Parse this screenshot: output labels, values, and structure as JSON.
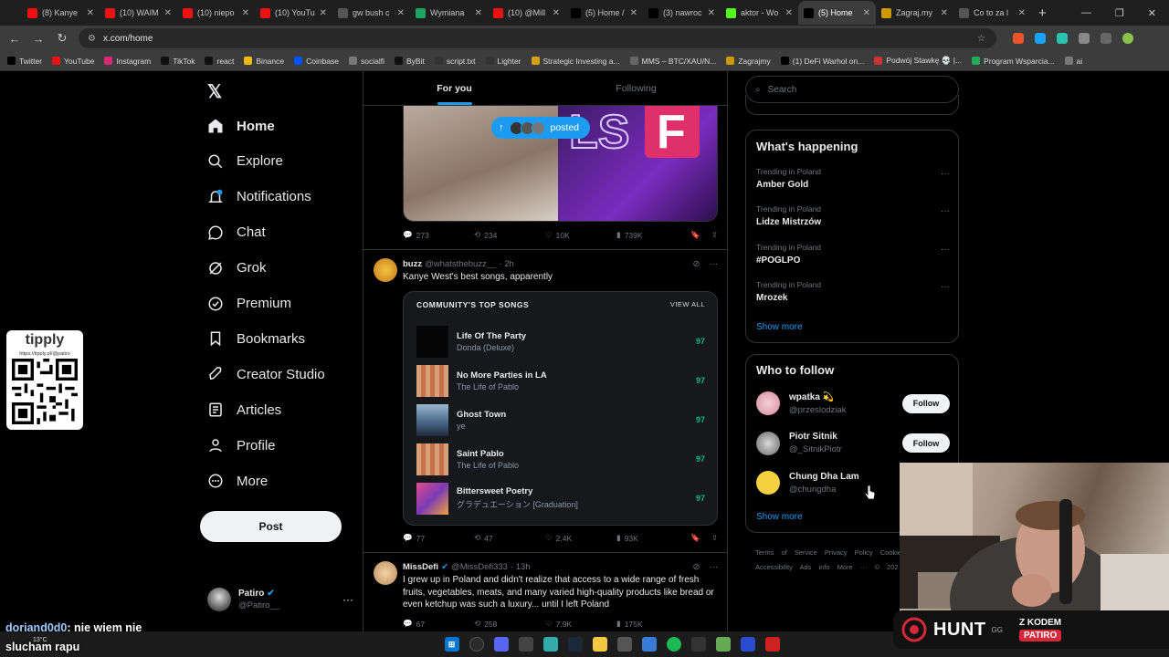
{
  "browser": {
    "tabs": [
      {
        "label": "(8) Kanye",
        "icon": "youtube-icon",
        "color": "#e11"
      },
      {
        "label": "(10) WAIM",
        "icon": "youtube-icon",
        "color": "#e11"
      },
      {
        "label": "(10) niepo",
        "icon": "youtube-icon",
        "color": "#e11"
      },
      {
        "label": "(10) YouTu",
        "icon": "youtube-icon",
        "color": "#e11"
      },
      {
        "label": "gw bush c",
        "icon": "google-icon",
        "color": "#555"
      },
      {
        "label": "Wymiana",
        "icon": "sheet-icon",
        "color": "#1da462"
      },
      {
        "label": "(10) @Mill",
        "icon": "youtube-icon",
        "color": "#e11"
      },
      {
        "label": "(5) Home /",
        "icon": "x-icon",
        "color": "#000"
      },
      {
        "label": "(3) nawroc",
        "icon": "x-icon",
        "color": "#000"
      },
      {
        "label": "aktor - Wo",
        "icon": "kick-icon",
        "color": "#53fc18"
      },
      {
        "label": "(5) Home",
        "icon": "x-icon",
        "color": "#000",
        "active": true
      },
      {
        "label": "Zagraj.my",
        "icon": "person-icon",
        "color": "#c90"
      },
      {
        "label": "Co to za l",
        "icon": "globe-icon",
        "color": "#555"
      }
    ],
    "new_tab": "+",
    "url": "x.com/home",
    "bookmarks": [
      {
        "label": "Twitter",
        "color": "#000"
      },
      {
        "label": "YouTube",
        "color": "#e11"
      },
      {
        "label": "Instagram",
        "color": "#d62976"
      },
      {
        "label": "TikTok",
        "color": "#111"
      },
      {
        "label": "react",
        "color": "#111"
      },
      {
        "label": "Binance",
        "color": "#f0b90b"
      },
      {
        "label": "Coinbase",
        "color": "#0052ff"
      },
      {
        "label": "socialfi",
        "color": "#777"
      },
      {
        "label": "ByBit",
        "color": "#111"
      },
      {
        "label": "script.txt",
        "color": "#333"
      },
      {
        "label": "Lighter",
        "color": "#333"
      },
      {
        "label": "Strategic Investing a...",
        "color": "#d4a017"
      },
      {
        "label": "MMS – BTC/XAU/N...",
        "color": "#666"
      },
      {
        "label": "Zagrajmy",
        "color": "#c90"
      },
      {
        "label": "(1) DeFi Warhol on...",
        "color": "#000"
      },
      {
        "label": "Podwój Stawkę 💀 |...",
        "color": "#c33"
      },
      {
        "label": "Program Wsparcia...",
        "color": "#2a5"
      },
      {
        "label": "ai",
        "color": "#777"
      }
    ]
  },
  "sidebar": {
    "nav": [
      {
        "label": "Home",
        "icon": "home-icon"
      },
      {
        "label": "Explore",
        "icon": "search-icon"
      },
      {
        "label": "Notifications",
        "icon": "bell-icon"
      },
      {
        "label": "Chat",
        "icon": "chat-icon"
      },
      {
        "label": "Grok",
        "icon": "grok-icon"
      },
      {
        "label": "Premium",
        "icon": "premium-icon"
      },
      {
        "label": "Bookmarks",
        "icon": "bookmark-icon"
      },
      {
        "label": "Creator Studio",
        "icon": "rocket-icon"
      },
      {
        "label": "Articles",
        "icon": "article-icon"
      },
      {
        "label": "Profile",
        "icon": "person-icon"
      },
      {
        "label": "More",
        "icon": "more-icon"
      }
    ],
    "post_label": "Post",
    "account": {
      "name": "Patiro",
      "handle": "@Patiro__"
    }
  },
  "timeline": {
    "tabs": [
      "For you",
      "Following"
    ],
    "posted_label": "posted",
    "tweet1": {
      "replies": "273",
      "reposts": "234",
      "likes": "10K",
      "views": "739K"
    },
    "tweet2": {
      "name": "buzz",
      "handle": "@whatsthebuzz__",
      "time": "· 2h",
      "text": "Kanye West's best songs, apparently",
      "card_title": "COMMUNITY'S TOP SONGS",
      "card_view_all": "VIEW ALL",
      "songs": [
        {
          "title": "Life Of The Party",
          "album": "Donda (Deluxe)",
          "score": "97"
        },
        {
          "title": "No More Parties in LA",
          "album": "The Life of Pablo",
          "score": "97"
        },
        {
          "title": "Ghost Town",
          "album": "ye",
          "score": "97"
        },
        {
          "title": "Saint Pablo",
          "album": "The Life of Pablo",
          "score": "97"
        },
        {
          "title": "Bittersweet Poetry",
          "album": "グラデュエーション [Graduation]",
          "score": "97"
        }
      ],
      "replies": "77",
      "reposts": "47",
      "likes": "2.4K",
      "views": "93K"
    },
    "tweet3": {
      "name": "MissDefi",
      "handle": "@MissDefi333",
      "time": "· 13h",
      "text": "I grew up in Poland and didn't realize that access to a wide range of fresh fruits, vegetables, meats, and many varied high-quality products like bread or even ketchup was such a luxury... until I left Poland",
      "replies": "67",
      "reposts": "258",
      "likes": "7.9K",
      "views": "175K"
    }
  },
  "right": {
    "search_placeholder": "Search",
    "happening_title": "What's happening",
    "trends": [
      {
        "context": "Trending in Poland",
        "topic": "Amber Gold"
      },
      {
        "context": "Trending in Poland",
        "topic": "Lidze Mistrzów"
      },
      {
        "context": "Trending in Poland",
        "topic": "#POGLPO"
      },
      {
        "context": "Trending in Poland",
        "topic": "Mrozek"
      }
    ],
    "show_more": "Show more",
    "who_title": "Who to follow",
    "who": [
      {
        "name": "wpatka 💫",
        "handle": "@przeslodziak",
        "follow": "Follow"
      },
      {
        "name": "Piotr Sitnik",
        "handle": "@_SitnikPiotr",
        "follow": "Follow"
      },
      {
        "name": "Chung Dha Lam",
        "handle": "@chungdha",
        "follow": ""
      }
    ],
    "who_show_more": "Show more",
    "footer": "Terms of Service  Privacy Policy  Cookie  Accessibility  Ads info  More ···  © 202"
  },
  "overlay": {
    "tipply_title": "tipply",
    "tipply_url": "https://tipply.pl/@patiro",
    "chat_user": "doriand0d0",
    "chat_text": ": nie wiem nie",
    "chat_text2": "slucham rapu",
    "weather": "13°C",
    "hunt_logo": "HUNT",
    "hunt_gg": "GG",
    "hunt_code_label": "Z KODEM",
    "hunt_code": "PATIRO"
  }
}
